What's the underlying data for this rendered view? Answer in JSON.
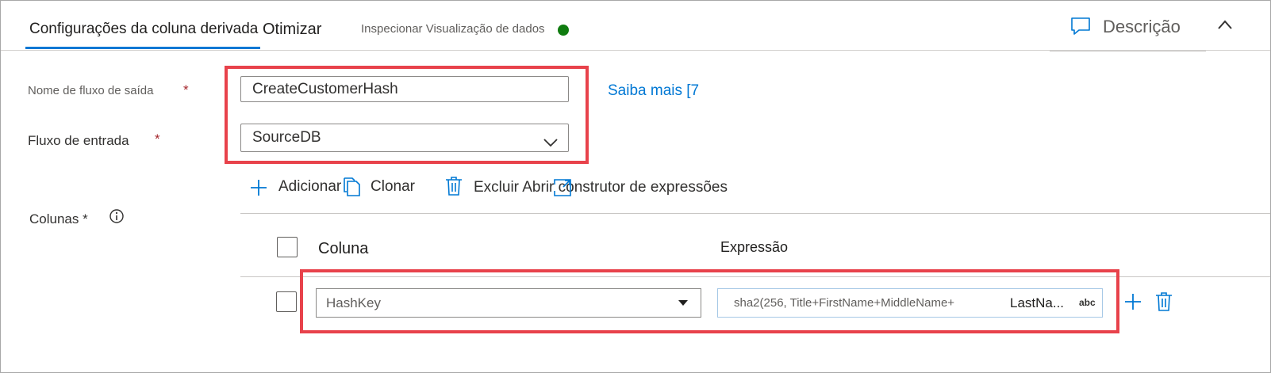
{
  "tabs": {
    "active": "Configurações da coluna derivada",
    "optimize": "Otimizar",
    "inspect": "Inspecionar Visualização de dados"
  },
  "header": {
    "description_label": "Descrição"
  },
  "form": {
    "output_stream_label": "Nome de fluxo de saída",
    "output_stream_value": "CreateCustomerHash",
    "required_mark": "*",
    "learn_more": "Saiba mais [7",
    "input_stream_label": "Fluxo de entrada",
    "input_stream_value": "SourceDB",
    "columns_label": "Colunas *"
  },
  "toolbar": {
    "add": "Adicionar",
    "clone": "Clonar",
    "delete": "Excluir",
    "open_builder": "Abrir construtor de expressões"
  },
  "table": {
    "headers": [
      "Coluna",
      "Expressão"
    ],
    "rows": [
      {
        "column": "HashKey",
        "expression": "sha2(256,  Title+FirstName+MiddleName+",
        "expression_tail": "LastNa...",
        "type_badge": "abc"
      }
    ]
  },
  "colors": {
    "accent": "#0078d4",
    "highlight": "#e8424b",
    "status": "#107c10"
  }
}
